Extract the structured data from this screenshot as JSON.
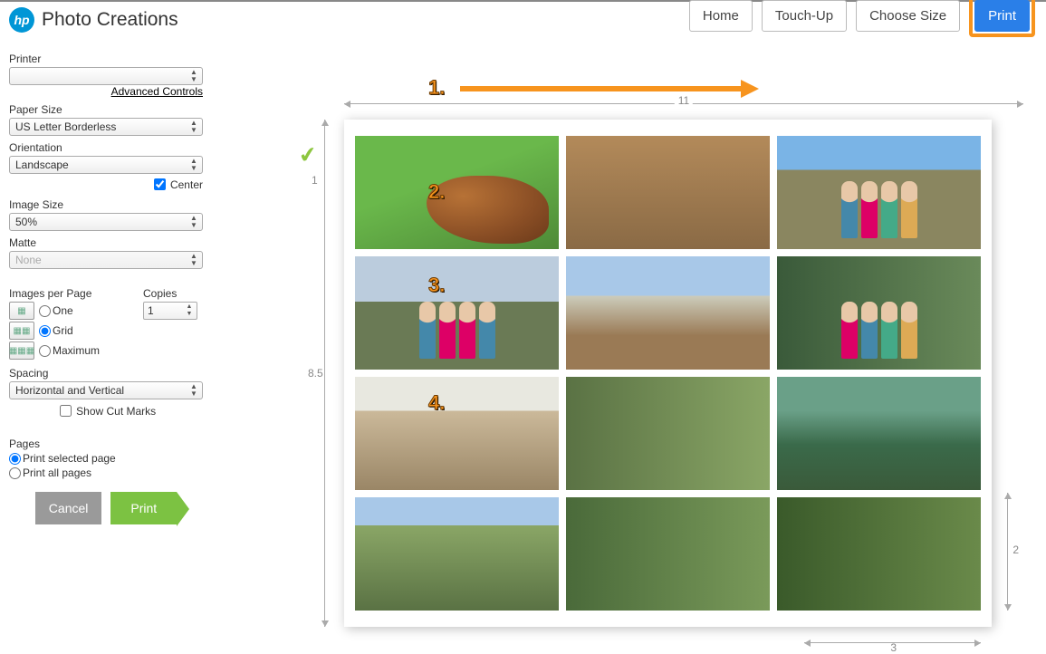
{
  "app": {
    "title": "Photo Creations",
    "logo_text": "hp"
  },
  "nav": {
    "home": "Home",
    "touchup": "Touch-Up",
    "choose_size": "Choose Size",
    "print": "Print"
  },
  "callouts": {
    "c1": "1.",
    "c2": "2.",
    "c3": "3.",
    "c4": "4."
  },
  "sidebar": {
    "printer_label": "Printer",
    "printer_value": "",
    "advanced_link": "Advanced Controls",
    "paper_size_label": "Paper Size",
    "paper_size_value": "US Letter Borderless",
    "orientation_label": "Orientation",
    "orientation_value": "Landscape",
    "center_label": "Center",
    "center_checked": true,
    "image_size_label": "Image Size",
    "image_size_value": "50%",
    "matte_label": "Matte",
    "matte_value": "None",
    "ipp_label": "Images per Page",
    "copies_label": "Copies",
    "copies_value": "1",
    "ipp_one": "One",
    "ipp_grid": "Grid",
    "ipp_max": "Maximum",
    "ipp_selected": "grid",
    "spacing_label": "Spacing",
    "spacing_value": "Horizontal and Vertical",
    "show_cut_marks_label": "Show Cut Marks",
    "show_cut_marks_checked": false,
    "pages_label": "Pages",
    "print_selected": "Print selected page",
    "print_all": "Print all pages",
    "pages_selected": "selected",
    "cancel": "Cancel",
    "print": "Print"
  },
  "preview": {
    "page_width": "11",
    "page_height": "8.5",
    "page_number": "1",
    "image_w": "3",
    "image_h": "2"
  }
}
